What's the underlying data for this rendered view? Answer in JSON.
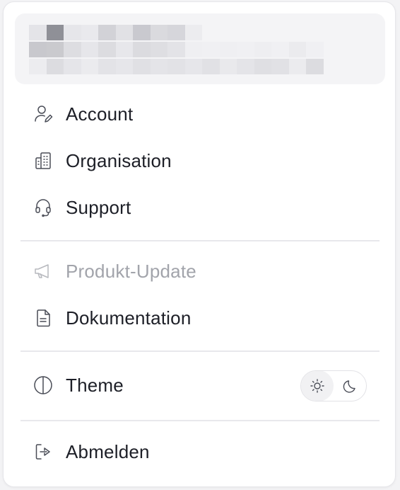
{
  "menu": {
    "items": [
      {
        "label": "Account",
        "icon": "user-edit-icon"
      },
      {
        "label": "Organisation",
        "icon": "building-icon"
      },
      {
        "label": "Support",
        "icon": "headset-icon"
      },
      {
        "label": "Produkt-Update",
        "icon": "megaphone-icon",
        "disabled": true
      },
      {
        "label": "Dokumentation",
        "icon": "document-icon"
      },
      {
        "label": "Theme",
        "icon": "contrast-icon"
      },
      {
        "label": "Abmelden",
        "icon": "sign-out-icon"
      }
    ],
    "theme": {
      "options": [
        "light",
        "dark"
      ],
      "selected": "light"
    }
  },
  "colors": {
    "text": "#1d1f27",
    "muted_text": "#a2a4ab",
    "icon": "#4a4d57",
    "divider": "#e8e8ec",
    "card_bg": "#f4f4f6"
  }
}
